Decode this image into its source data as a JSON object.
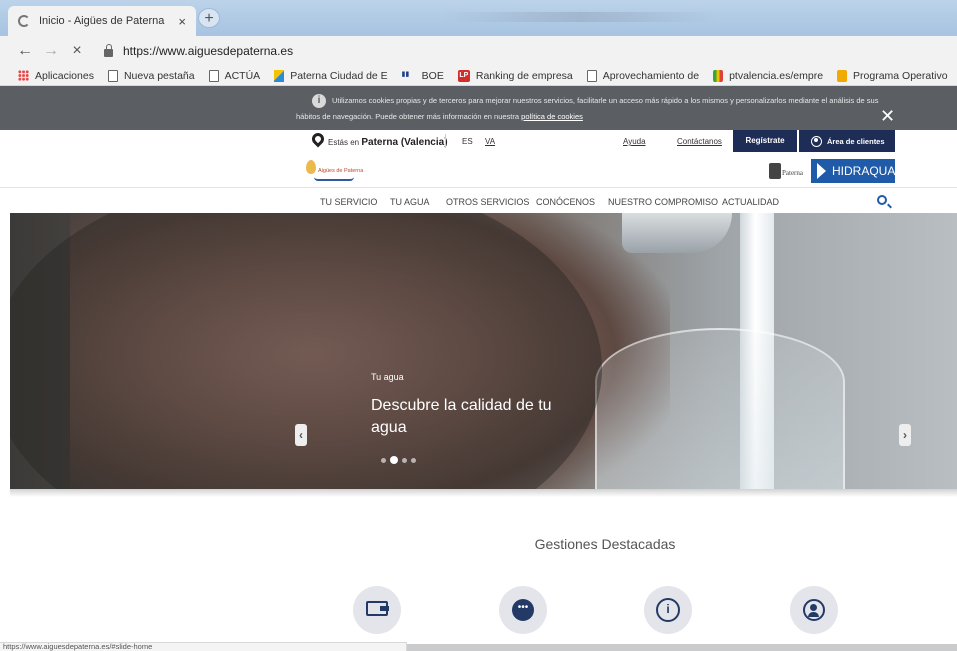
{
  "browser": {
    "tab_title": "Inicio - Aigües de Paterna",
    "tab_close": "×",
    "new_tab": "+",
    "url": "https://www.aiguesdepaterna.es",
    "back": "←",
    "forward": "→",
    "stop": "×",
    "bookmarks": [
      {
        "label": "Aplicaciones",
        "icon": "apps-icon"
      },
      {
        "label": "Nueva pestaña",
        "icon": "page-icon"
      },
      {
        "label": "ACTÚA",
        "icon": "page-icon"
      },
      {
        "label": "Paterna Ciudad de E",
        "icon": "flag-icon"
      },
      {
        "label": "BOE",
        "icon": "boe-icon"
      },
      {
        "label": "Ranking de empresa",
        "icon": "lp-icon"
      },
      {
        "label": "Aprovechamiento de",
        "icon": "page-icon"
      },
      {
        "label": "ptvalencia.es/empre",
        "icon": "pt-icon"
      },
      {
        "label": "Programa Operativo",
        "icon": "po-icon"
      }
    ],
    "status_url": "https://www.aiguesdepaterna.es/#slide-home"
  },
  "cookie": {
    "line1": "Utilizamos cookies propias y de terceros para mejorar nuestros servicios, facilitarle un acceso más rápido a los mismos y personalizarlos mediante el análisis de sus",
    "line2_prefix": "hábitos de navegación. Puede obtener más información en nuestra",
    "line2_link": "política de cookies",
    "close": "✕"
  },
  "utility": {
    "location_prefix": "Estás en",
    "location": "Paterna (Valencia)",
    "lang_es": "ES",
    "lang_va": "VA",
    "help": "Ayuda",
    "contact": "Contáctanos",
    "register": "Regístrate",
    "client_area": "Área de clientes"
  },
  "logos": {
    "brand": "Aigües de Paterna",
    "paterna": "Paterna",
    "hidraqua": "HIDRAQUA"
  },
  "nav": {
    "items": [
      "TU SERVICIO",
      "TU AGUA",
      "OTROS SERVICIOS",
      "CONÓCENOS",
      "NUESTRO COMPROMISO",
      "ACTUALIDAD"
    ]
  },
  "hero": {
    "category": "Tu agua",
    "title": "Descubre la calidad de tu agua",
    "prev": "‹",
    "next": "›",
    "slide_count": 4,
    "active_slide": 2
  },
  "section": {
    "title": "Gestiones Destacadas",
    "icons": [
      "wallet-icon",
      "chat-icon",
      "info-icon",
      "person-icon"
    ]
  }
}
